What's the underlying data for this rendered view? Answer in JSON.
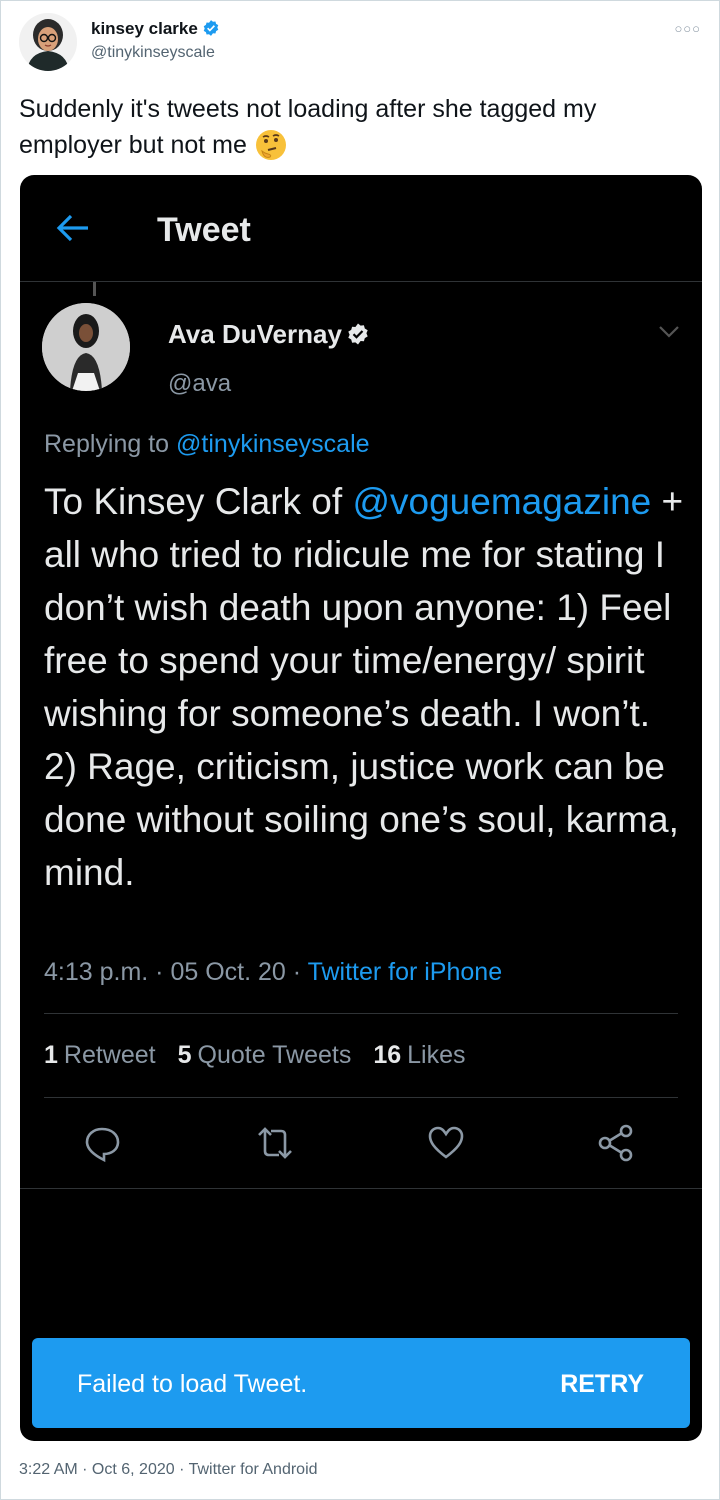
{
  "author": {
    "name": "kinsey clarke",
    "handle": "@tinykinseyscale",
    "verified": true
  },
  "tweet": {
    "text": "Suddenly it's tweets not loading after she tagged my employer but not me",
    "emoji": "thinking-face",
    "footer": "3:22 AM · Oct 6, 2020 · Twitter for Android"
  },
  "screenshot": {
    "header_title": "Tweet",
    "quoted": {
      "name": "Ava DuVernay",
      "handle": "@ava",
      "verified": true,
      "replying_prefix": "Replying to",
      "replying_handle": "@tinykinseyscale",
      "text_part1": "To Kinsey Clark of",
      "mention": "@voguemagazine",
      "text_part2": "+ all who tried to ridicule me for stating I don’t wish death upon anyone: 1) Feel free to spend your time/energy/ spirit wishing for someone’s death. I won’t. 2) Rage, criticism, justice work can be done without soiling one’s soul, karma, mind.",
      "time": "4:13 p.m. · 05 Oct. 20 ·",
      "source": "Twitter for iPhone"
    },
    "stats": {
      "retweets_count": "1",
      "retweets_label": "Retweet",
      "quotes_count": "5",
      "quotes_label": "Quote Tweets",
      "likes_count": "16",
      "likes_label": "Likes"
    },
    "actions": [
      "reply-icon",
      "retweet-icon",
      "like-icon",
      "share-icon"
    ],
    "toast": {
      "message": "Failed to load Tweet.",
      "action": "RETRY"
    }
  },
  "colors": {
    "accent": "#1d9bf0",
    "dark_bg": "#000000",
    "muted": "#8b98a5"
  }
}
